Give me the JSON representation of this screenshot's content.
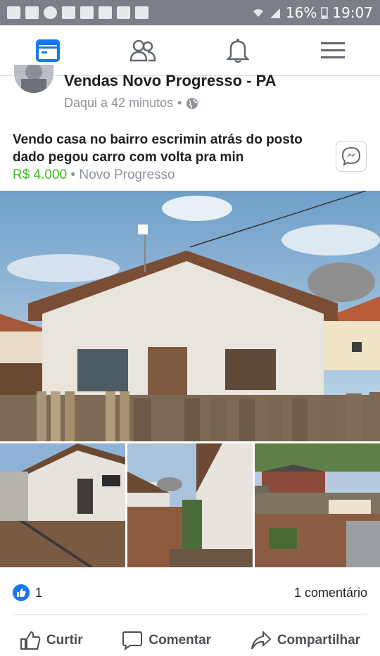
{
  "status_bar": {
    "notification_icons": [
      "facebook-icon",
      "facebook-icon",
      "whatsapp-icon",
      "vpn-icon",
      "download-icon",
      "email-icon",
      "flipboard-icon",
      "voicemail-icon"
    ],
    "battery": "16%",
    "time": "19:07"
  },
  "nav": {
    "items": [
      "news-feed-icon",
      "friends-icon",
      "notifications-icon",
      "menu-icon"
    ],
    "active_color": "#1877f2",
    "icon_color": "#606770"
  },
  "post": {
    "group_name": "Vendas Novo Progresso - PA",
    "time": "Daqui a 42 minutos",
    "separator": "•",
    "text": "Vendo casa no bairro escrimin atrás do posto dado pegou carro com volta pra min",
    "price": "R$ 4.000",
    "location_separator": "•",
    "location": "Novo Progresso",
    "price_color": "#42b72a"
  },
  "engagement": {
    "likes": "1",
    "comments": "1 comentário"
  },
  "actions": {
    "like": "Curtir",
    "comment": "Comentar",
    "share": "Compartilhar"
  }
}
